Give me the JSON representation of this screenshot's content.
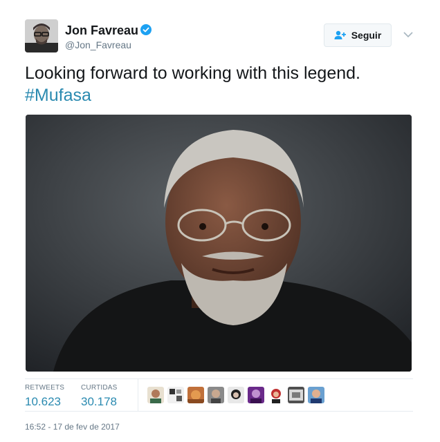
{
  "author": {
    "name": "Jon Favreau",
    "handle": "@Jon_Favreau",
    "verified": true
  },
  "follow_button": {
    "label": "Seguir",
    "icon": "add-user-icon"
  },
  "tweet": {
    "text": "Looking forward to working with this legend.",
    "hashtag": "#Mufasa"
  },
  "stats": {
    "retweets_label": "RETWEETS",
    "retweets_value": "10.623",
    "likes_label": "CURTIDAS",
    "likes_value": "30.178"
  },
  "likers": [
    "liker-avatar-1",
    "liker-avatar-2",
    "liker-avatar-3",
    "liker-avatar-4",
    "liker-avatar-5",
    "liker-avatar-6",
    "liker-avatar-7",
    "liker-avatar-8",
    "liker-avatar-9"
  ],
  "timestamp": "16:52 - 17 de fev de 2017",
  "colors": {
    "link": "#2a8ab0",
    "verified": "#1da1f2",
    "muted": "#657786",
    "divider": "#e6ecf0"
  }
}
